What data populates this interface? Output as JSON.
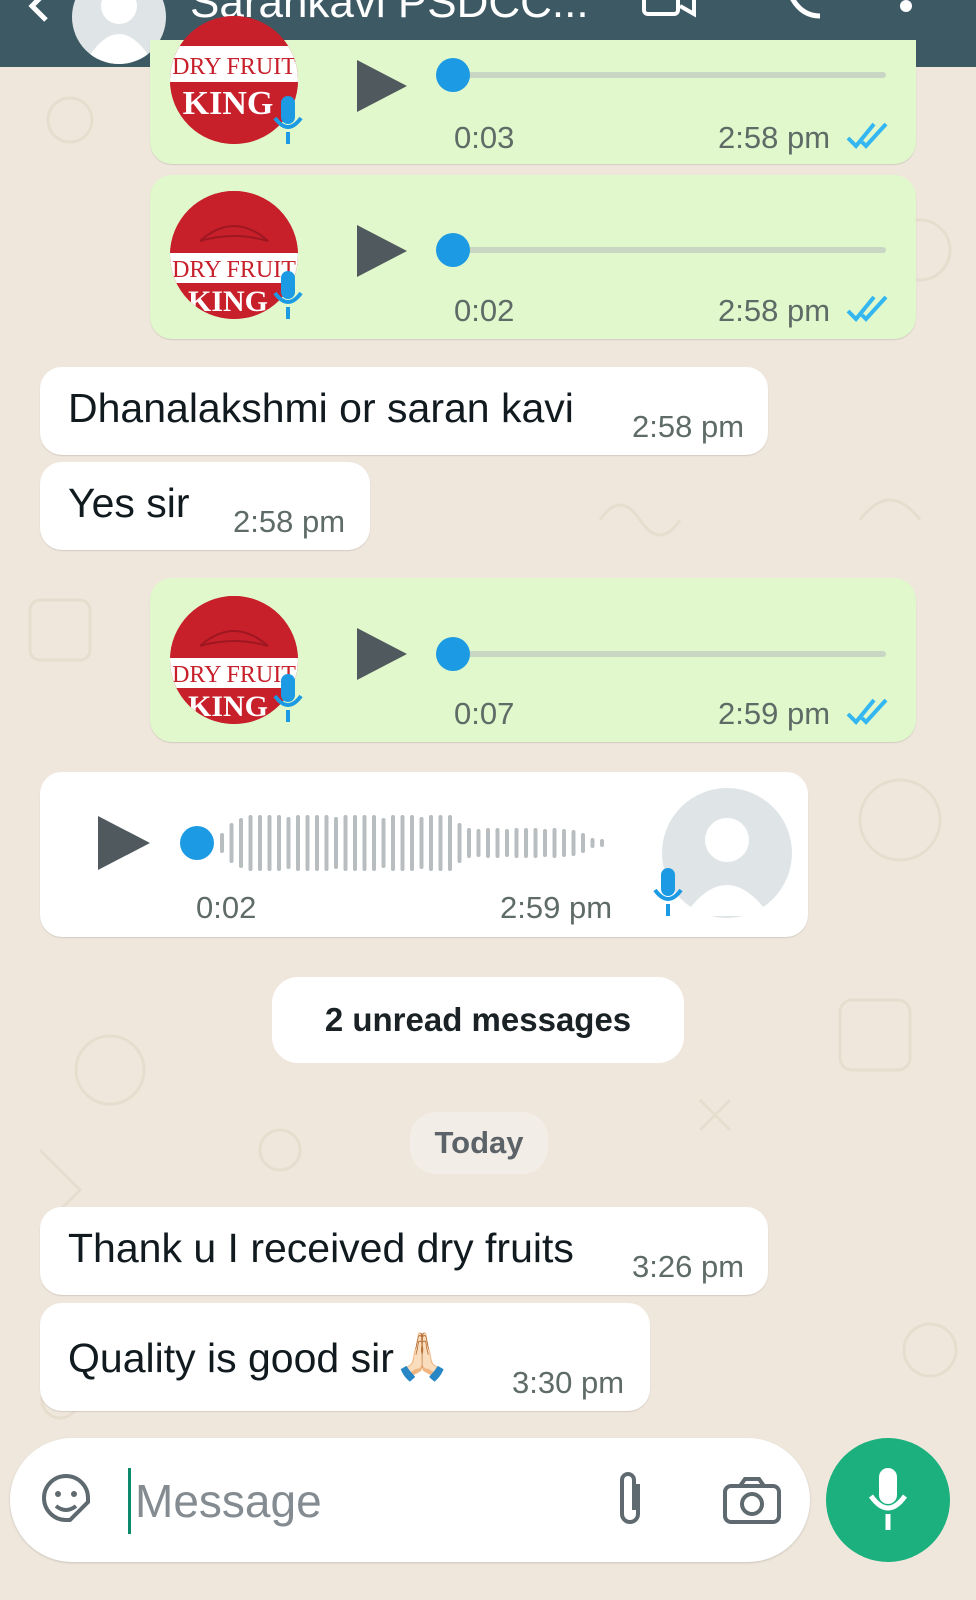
{
  "header": {
    "contact_name": "Sarankavi PSDCC..."
  },
  "messages": [
    {
      "kind": "voice_out",
      "duration": "0:03",
      "time": "2:58 pm"
    },
    {
      "kind": "voice_out",
      "duration": "0:02",
      "time": "2:58 pm"
    },
    {
      "kind": "text_in",
      "text": "Dhanalakshmi or saran kavi",
      "time": "2:58 pm"
    },
    {
      "kind": "text_in",
      "text": "Yes sir",
      "time": "2:58 pm"
    },
    {
      "kind": "voice_out",
      "duration": "0:07",
      "time": "2:59 pm"
    },
    {
      "kind": "voice_in",
      "duration": "0:02",
      "time": "2:59 pm"
    },
    {
      "kind": "text_in",
      "text": "Thank u I received dry fruits",
      "time": "3:26 pm"
    },
    {
      "kind": "text_in",
      "text": "Quality is good sir",
      "emoji": "🙏🏻",
      "time": "3:30 pm"
    }
  ],
  "avatar_logo": {
    "line1": "DRY FRUIT",
    "line2": "KING"
  },
  "unread_banner": "2 unread messages",
  "date_chip": "Today",
  "composer": {
    "placeholder": "Message"
  },
  "colors": {
    "header": "#3d5a64",
    "outgoing_bubble": "#e0f8cb",
    "incoming_bubble": "#ffffff",
    "read_ticks": "#34b7f1",
    "mic_fab": "#1bb07d",
    "voice_knob": "#1c9ae3"
  },
  "icons": [
    "back-icon",
    "video-call-icon",
    "phone-icon",
    "menu-icon",
    "play-icon",
    "mic-icon",
    "double-tick-icon",
    "sticker-icon",
    "attach-icon",
    "camera-icon"
  ]
}
